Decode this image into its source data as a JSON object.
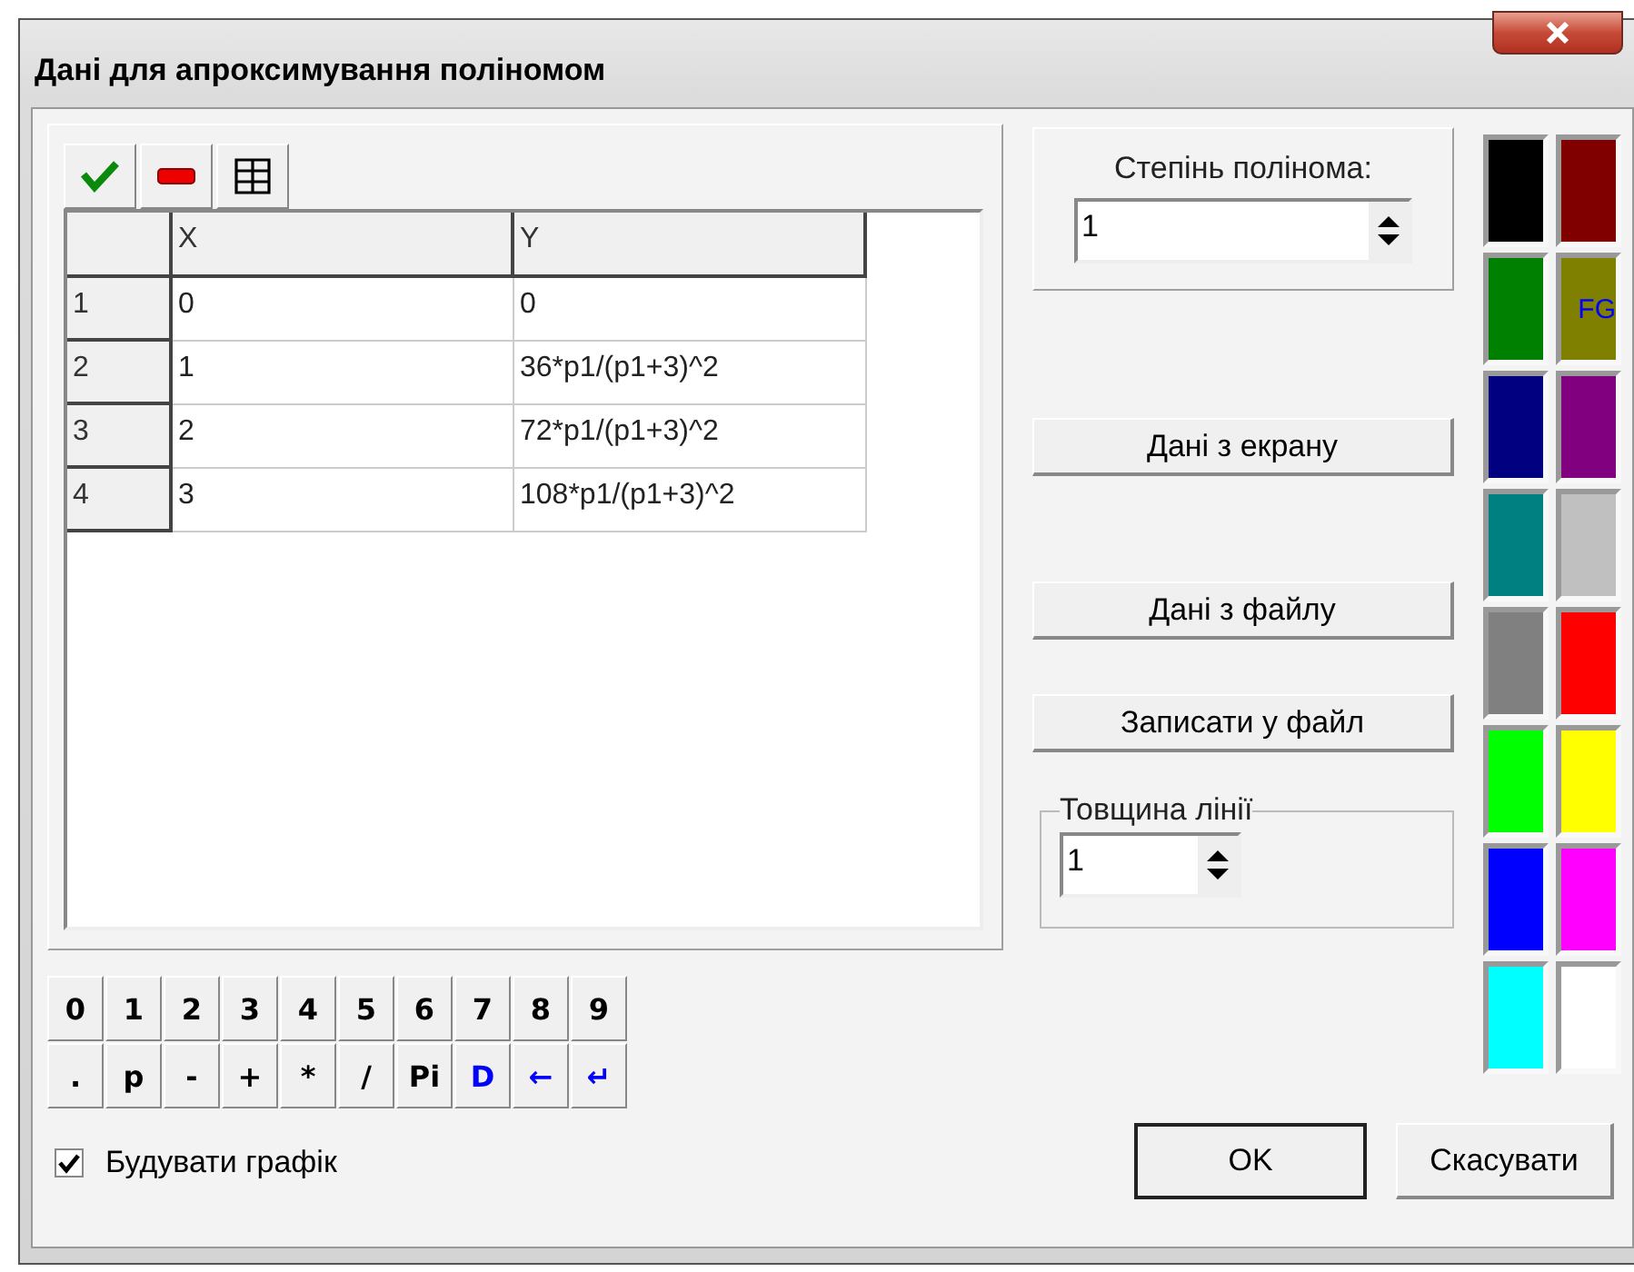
{
  "window": {
    "title": "Дані для апроксимування поліномом"
  },
  "table": {
    "columns": [
      "X",
      "Y"
    ],
    "rows": [
      {
        "index": "1",
        "cells": [
          "0",
          "0"
        ]
      },
      {
        "index": "2",
        "cells": [
          "1",
          "36*p1/(p1+3)^2"
        ]
      },
      {
        "index": "3",
        "cells": [
          "2",
          "72*p1/(p1+3)^2"
        ]
      },
      {
        "index": "4",
        "cells": [
          "3",
          "108*p1/(p1+3)^2"
        ]
      }
    ]
  },
  "keypad": [
    [
      {
        "label": "0",
        "kind": "plain"
      },
      {
        "label": "1",
        "kind": "plain"
      },
      {
        "label": "2",
        "kind": "plain"
      },
      {
        "label": "3",
        "kind": "plain"
      },
      {
        "label": "4",
        "kind": "plain"
      },
      {
        "label": "5",
        "kind": "plain"
      },
      {
        "label": "6",
        "kind": "plain"
      },
      {
        "label": "7",
        "kind": "plain"
      },
      {
        "label": "8",
        "kind": "plain"
      },
      {
        "label": "9",
        "kind": "plain"
      }
    ],
    [
      {
        "label": ".",
        "kind": "plain"
      },
      {
        "label": "p",
        "kind": "plain"
      },
      {
        "label": "-",
        "kind": "plain"
      },
      {
        "label": "+",
        "kind": "plain"
      },
      {
        "label": "*",
        "kind": "plain"
      },
      {
        "label": "/",
        "kind": "plain"
      },
      {
        "label": "Pi",
        "kind": "plain"
      },
      {
        "label": "D",
        "kind": "accent"
      },
      {
        "label": "←",
        "kind": "accent"
      },
      {
        "label": "↵",
        "kind": "accent"
      }
    ]
  ],
  "plot_checkbox": {
    "label": "Будувати графік",
    "checked": true
  },
  "degree": {
    "label": "Степінь полінома:",
    "value": "1"
  },
  "buttons": [
    "Дані з екрану",
    "Дані з файлу",
    "Записати у файл"
  ],
  "line_width": {
    "label": "Товщина лінії",
    "value": "1"
  },
  "colors": [
    {
      "color": "#000000"
    },
    {
      "color": "#800000"
    },
    {
      "color": "#008000"
    },
    {
      "color": "#808000",
      "label": "FG"
    },
    {
      "color": "#000080"
    },
    {
      "color": "#800080"
    },
    {
      "color": "#008080"
    },
    {
      "color": "#c0c0c0"
    },
    {
      "color": "#808080"
    },
    {
      "color": "#ff0000"
    },
    {
      "color": "#00ff00"
    },
    {
      "color": "#ffff00"
    },
    {
      "color": "#0000ff"
    },
    {
      "color": "#ff00ff"
    },
    {
      "color": "#00ffff"
    },
    {
      "color": "#ffffff"
    }
  ],
  "dialog_buttons": [
    {
      "label": "OK",
      "default": true
    },
    {
      "label": "Скасувати",
      "default": false
    }
  ]
}
